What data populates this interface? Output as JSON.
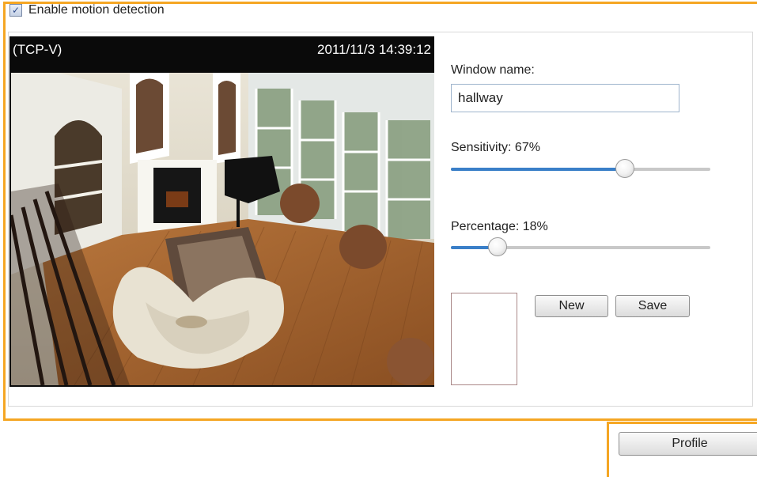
{
  "motion": {
    "enable_label": "Enable motion detection",
    "enabled": true
  },
  "video": {
    "codec_label": "(TCP-V)",
    "timestamp": "2011/11/3 14:39:12"
  },
  "window": {
    "name_label": "Window name:",
    "name_value": "hallway"
  },
  "sensitivity": {
    "label": "Sensitivity: 67%",
    "value_percent": 67
  },
  "percentage": {
    "label": "Percentage: 18%",
    "value_percent": 18
  },
  "buttons": {
    "new_label": "New",
    "save_label": "Save",
    "profile_label": "Profile"
  },
  "colors": {
    "highlight": "#f5a623",
    "slider_fill": "#3a7fc8"
  }
}
